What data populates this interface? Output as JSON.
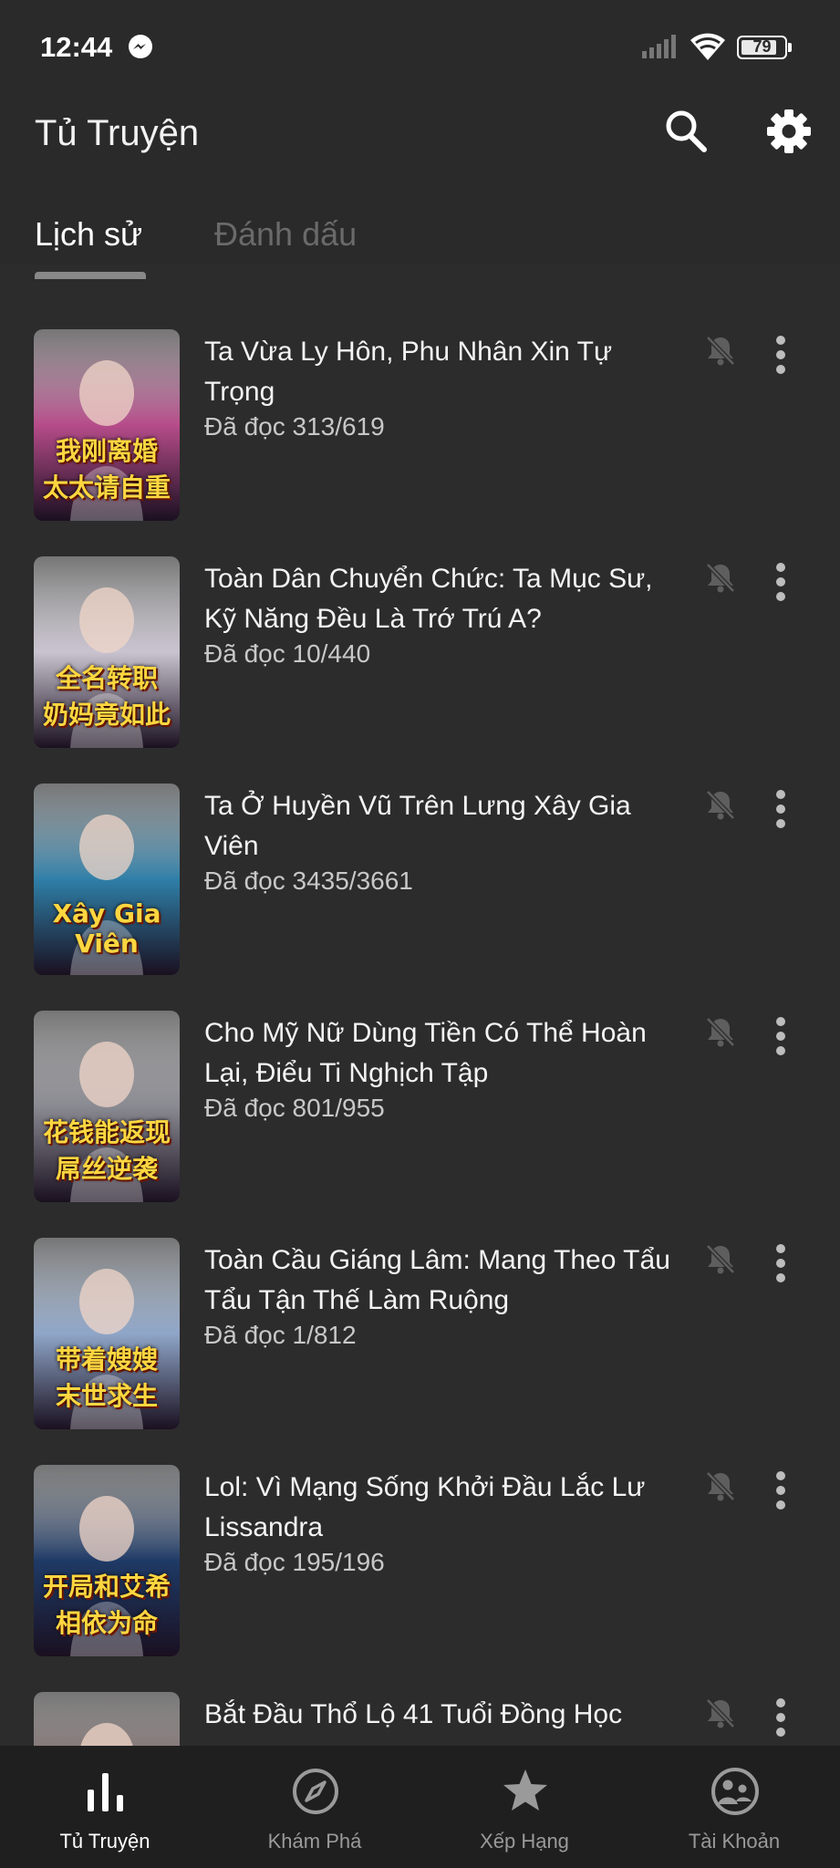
{
  "status": {
    "time": "12:44",
    "battery": "79"
  },
  "header": {
    "title": "Tủ Truyện"
  },
  "tabs": [
    {
      "label": "Lịch sử",
      "active": true
    },
    {
      "label": "Đánh dấu",
      "active": false
    }
  ],
  "items": [
    {
      "title": "Ta Vừa Ly Hôn, Phu Nhân Xin Tự Trọng",
      "progress": "Đã đọc 313/619",
      "cover_text": "我刚离婚\n太太请自重",
      "cover_color": "#b64c8a"
    },
    {
      "title": "Toàn Dân Chuyển Chức: Ta Mục Sư, Kỹ Năng Đều Là Trớ Trú A?",
      "progress": "Đã đọc 10/440",
      "cover_text": "全名转职\n奶妈竟如此",
      "cover_color": "#c9c3cf"
    },
    {
      "title": "Ta Ở Huyền Vũ Trên Lưng Xây Gia Viên",
      "progress": "Đã đọc 3435/3661",
      "cover_text": "Xây Gia Viên",
      "cover_color": "#2f7fa8"
    },
    {
      "title": "Cho Mỹ Nữ Dùng Tiền Có Thể Hoàn Lại, Điểu Ti Nghịch Tập",
      "progress": "Đã đọc 801/955",
      "cover_text": "花钱能返现\n屌丝逆袭",
      "cover_color": "#8a8a92"
    },
    {
      "title": "Toàn Cầu Giáng Lâm: Mang Theo Tẩu Tẩu Tận Thế Làm Ruộng",
      "progress": "Đã đọc 1/812",
      "cover_text": "带着嫂嫂\n末世求生",
      "cover_color": "#8fa6c8"
    },
    {
      "title": "Lol: Vì Mạng Sống Khởi Đầu Lắc Lư Lissandra",
      "progress": "Đã đọc 195/196",
      "cover_text": "开局和艾希\n相依为命",
      "cover_color": "#1e3a66"
    },
    {
      "title": "Bắt Đầu Thổ Lộ 41 Tuổi Đồng Học",
      "progress": "",
      "cover_text": "",
      "cover_color": "#6b4a4a"
    }
  ],
  "nav": [
    {
      "label": "Tủ Truyện",
      "icon": "bar-chart-icon",
      "active": true
    },
    {
      "label": "Khám Phá",
      "icon": "compass-icon",
      "active": false
    },
    {
      "label": "Xếp Hạng",
      "icon": "star-icon",
      "active": false
    },
    {
      "label": "Tài Khoản",
      "icon": "account-icon",
      "active": false
    }
  ]
}
